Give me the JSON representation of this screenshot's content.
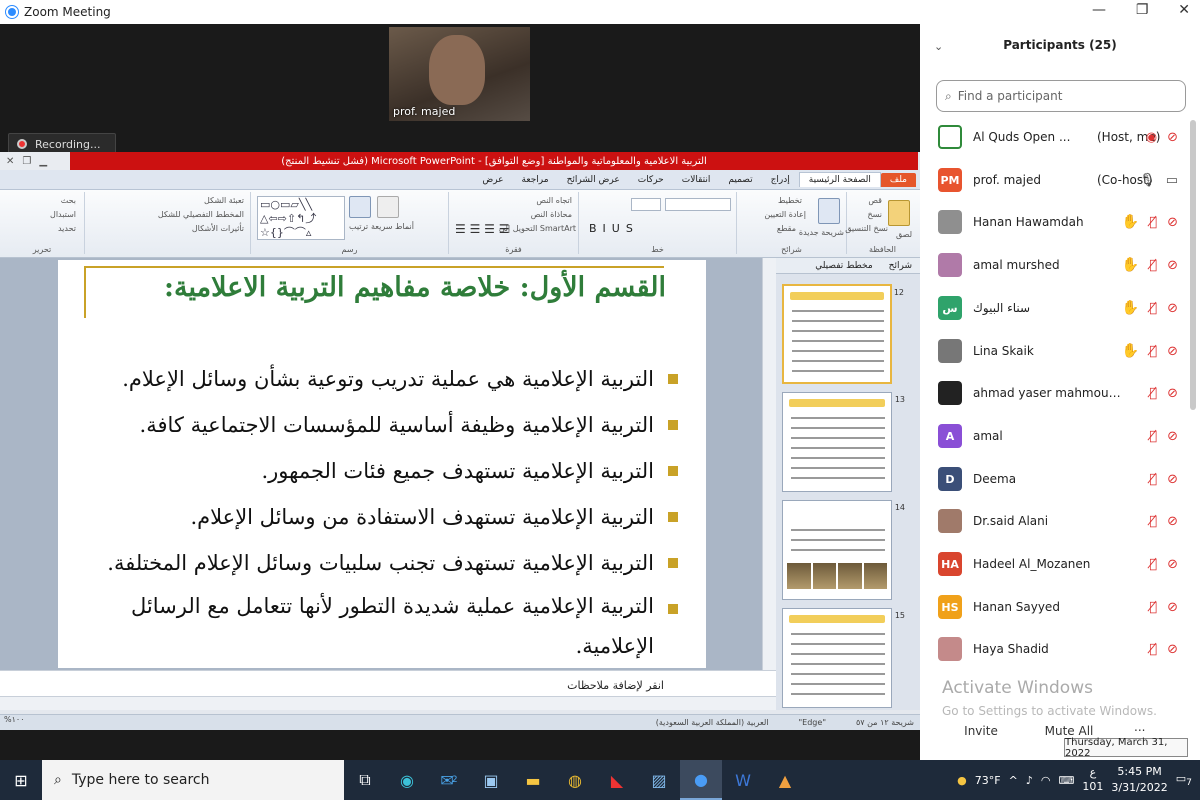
{
  "zoom": {
    "window_title": "Zoom Meeting",
    "video_caption": "prof. majed",
    "recording_label": "Recording..."
  },
  "ppt": {
    "title": "التربية الاعلامية والمعلوماتية والمواطنة [وضع التوافق] - Microsoft PowerPoint (فشل تنشيط المنتج)",
    "tabs": [
      "ملف",
      "الصفحة الرئيسية",
      "إدراج",
      "تصميم",
      "انتقالات",
      "حركات",
      "عرض الشرائح",
      "مراجعة",
      "عرض"
    ],
    "ribbon": {
      "clipboard_label": "الحافظة",
      "slides_label": "شرائح",
      "font_label": "خط",
      "paragraph_label": "فقرة",
      "drawing_label": "رسم",
      "editing_label": "تحرير",
      "paste": "لصق",
      "cut": "قص",
      "copy": "نسخ",
      "format_painter": "نسخ التنسيق",
      "new_slide": "شريحة جديدة",
      "layout": "تخطيط",
      "reset": "إعادة التعيين",
      "section": "مقطع",
      "text_direction": "اتجاه النص",
      "align_text": "محاذاة النص",
      "smartart": "التحويل إلى SmartArt",
      "arrange": "ترتيب",
      "quick_styles": "أنماط سريعة",
      "shape_fill": "تعبئة الشكل",
      "shape_outline": "المخطط التفصيلي للشكل",
      "shape_effects": "تأثيرات الأشكال",
      "find": "بحث",
      "replace": "استبدال",
      "select": "تحديد"
    },
    "slide": {
      "title": "القسم الأول: خلاصة مفاهيم التربية الاعلامية:",
      "bullets": [
        "التربية الإعلامية هي عملية تدريب وتوعية بشأن وسائل الإعلام.",
        "التربية الإعلامية وظيفة أساسية للمؤسسات الاجتماعية كافة.",
        "التربية الإعلامية تستهدف جميع فئات الجمهور.",
        "التربية الإعلامية تستهدف الاستفادة من وسائل الإعلام.",
        "التربية الإعلامية تستهدف تجنب سلبيات وسائل الإعلام المختلفة.",
        "التربية الإعلامية عملية شديدة التطور لأنها تتعامل مع الرسائل الإعلامية."
      ]
    },
    "thumbs_tabs": [
      "شرائح",
      "مخطط تفصيلي"
    ],
    "thumb_numbers": [
      "12",
      "13",
      "14",
      "15"
    ],
    "notes_placeholder": "انقر لإضافة ملاحظات",
    "status": {
      "slide_info": "شريحة ١٢ من ٥٧",
      "theme": "\"Edge\"",
      "language": "العربية (المملكة العربية السعودية)",
      "zoom": "%١٠٠"
    }
  },
  "participants": {
    "title": "Participants (25)",
    "search_placeholder": "Find a participant",
    "list": [
      {
        "name": "Al Quds Open ...",
        "tag": "(Host, me)",
        "avatar": "",
        "color": "#ffffff",
        "hand": false,
        "mic": "rec",
        "cam": "off"
      },
      {
        "name": "prof. majed",
        "tag": "(Co-host)",
        "avatar": "PM",
        "color": "#e8542f",
        "hand": false,
        "mic": "on",
        "cam": "on"
      },
      {
        "name": "Hanan Hawamdah",
        "tag": "",
        "avatar": "",
        "color": "#8f8f8f",
        "hand": true,
        "mic": "off",
        "cam": "off"
      },
      {
        "name": "amal murshed",
        "tag": "",
        "avatar": "",
        "color": "#b07aa8",
        "hand": true,
        "mic": "off",
        "cam": "off"
      },
      {
        "name": "سناء البيوك",
        "tag": "",
        "avatar": "س",
        "color": "#2fa36b",
        "hand": true,
        "mic": "off",
        "cam": "off"
      },
      {
        "name": "Lina Skaik",
        "tag": "",
        "avatar": "",
        "color": "#777777",
        "hand": true,
        "mic": "off",
        "cam": "off"
      },
      {
        "name": "ahmad yaser mahmoud salag ...",
        "tag": "",
        "avatar": "",
        "color": "#222222",
        "hand": false,
        "mic": "off",
        "cam": "off"
      },
      {
        "name": "amal",
        "tag": "",
        "avatar": "A",
        "color": "#8a4fd6",
        "hand": false,
        "mic": "off",
        "cam": "off"
      },
      {
        "name": "Deema",
        "tag": "",
        "avatar": "D",
        "color": "#3b4f78",
        "hand": false,
        "mic": "off",
        "cam": "off"
      },
      {
        "name": "Dr.said Alani",
        "tag": "",
        "avatar": "",
        "color": "#a07a6a",
        "hand": false,
        "mic": "off",
        "cam": "off"
      },
      {
        "name": "Hadeel Al_Mozanen",
        "tag": "",
        "avatar": "HA",
        "color": "#d9452e",
        "hand": false,
        "mic": "off",
        "cam": "off"
      },
      {
        "name": "Hanan Sayyed",
        "tag": "",
        "avatar": "HS",
        "color": "#f0a11a",
        "hand": false,
        "mic": "off",
        "cam": "off"
      },
      {
        "name": "Haya Shadid",
        "tag": "",
        "avatar": "",
        "color": "#c48a8a",
        "hand": false,
        "mic": "off",
        "cam": "off"
      }
    ],
    "invite": "Invite",
    "mute_all": "Mute All",
    "more": "...",
    "activate_title": "Activate Windows",
    "activate_sub": "Go to Settings to activate Windows.",
    "tooltip": "Thursday, March 31, 2022"
  },
  "taskbar": {
    "search_placeholder": "Type here to search",
    "temperature": "73°F",
    "lang_top": "ع",
    "lang_bottom": "101",
    "time": "5:45 PM",
    "date": "3/31/2022",
    "notif_count": "7",
    "mail_badge": "2"
  }
}
